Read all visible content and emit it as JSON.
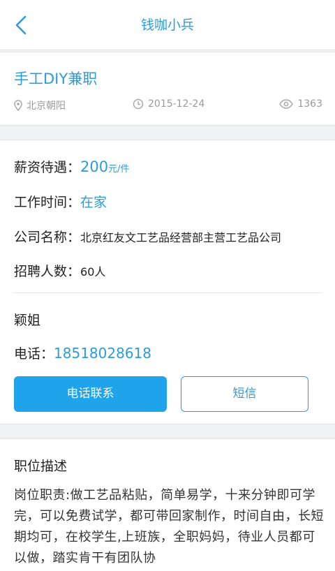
{
  "header": {
    "title": "钱咖小兵"
  },
  "job": {
    "title": "手工DIY兼职",
    "location": "北京朝阳",
    "date": "2015-12-24",
    "views": "1363"
  },
  "details": {
    "salary_label": "薪资待遇：",
    "salary_value": "200",
    "salary_unit": "元/件",
    "time_label": "工作时间：",
    "time_value": "在家",
    "company_label": "公司名称：",
    "company_value": "北京红友文工艺品经营部主营工艺品公司",
    "count_label": "招聘人数：",
    "count_value": "60人",
    "contact_name": "颖姐",
    "phone_label": "电话：",
    "phone_value": "18518028618",
    "call_button": "电话联系",
    "sms_button": "短信"
  },
  "description": {
    "title": "职位描述",
    "body": "岗位职责:做工艺品粘贴，简单易学，十来分钟即可学完，可以免费试学，都可带回家制作，时间自由，长短期均可，在校学生,上班族，全职妈妈，待业人员都可以做，踏实肯干有团队协"
  },
  "colors": {
    "accent": "#2d9bd8",
    "button": "#1fa3ea"
  }
}
